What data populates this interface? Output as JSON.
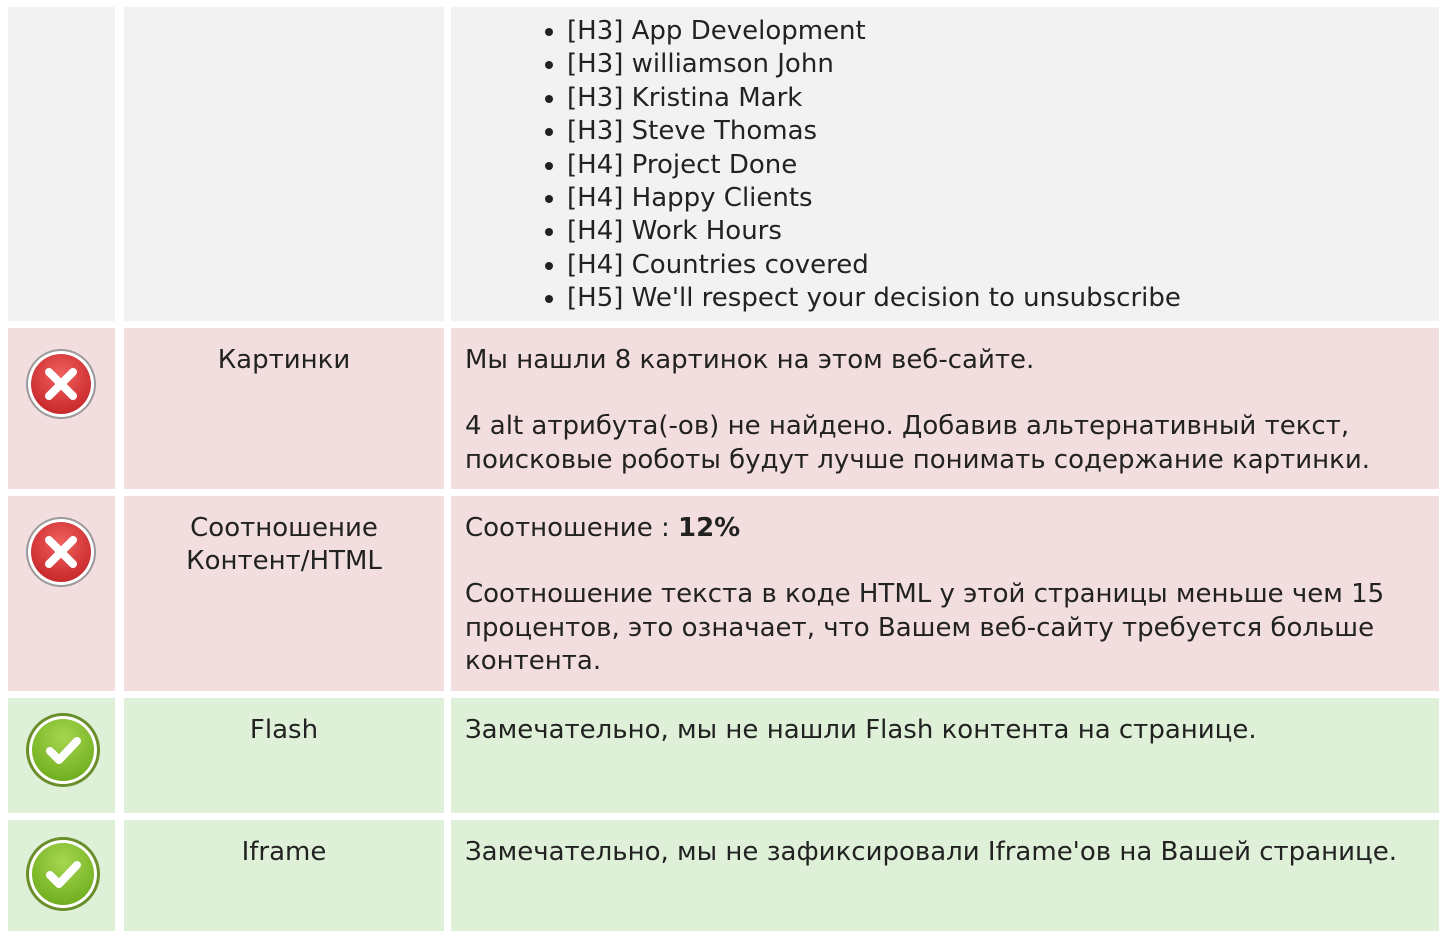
{
  "headings": [
    "[H3] App Development",
    "[H3] williamson John",
    "[H3] Kristina Mark",
    "[H3] Steve Thomas",
    "[H4] Project Done",
    "[H4] Happy Clients",
    "[H4] Work Hours",
    "[H4] Countries covered",
    "[H5] We'll respect your decision to unsubscribe"
  ],
  "rows": [
    {
      "status": "error",
      "icon": "error-x-icon",
      "name": "Картинки",
      "desc": [
        "Мы нашли 8 картинок на этом веб-сайте.",
        "4 alt атрибута(-ов) не найдено. Добавив альтернативный текст, поисковые роботы будут лучше понимать содержание картинки."
      ]
    },
    {
      "status": "error",
      "icon": "error-x-icon",
      "name_line1": "Соотношение",
      "name_line2": "Контент/HTML",
      "ratio_label": "Соотношение : ",
      "ratio_value": "12%",
      "desc2": "Соотношение текста в коде HTML у этой страницы меньше чем 15 процентов, это означает, что Вашем веб-сайту требуется больше контента."
    },
    {
      "status": "ok",
      "icon": "success-check-icon",
      "name": "Flash",
      "desc": "Замечательно, мы не нашли Flash контента на странице."
    },
    {
      "status": "ok",
      "icon": "success-check-icon",
      "name": "Iframe",
      "desc": "Замечательно, мы не зафиксировали Iframe'ов на Вашей странице."
    }
  ],
  "colors": {
    "neutral_bg": "#f2f2f2",
    "error_bg": "#f2dede",
    "ok_bg": "#dff0d8",
    "error_icon": "#d9383a",
    "ok_icon": "#8cc63e"
  }
}
